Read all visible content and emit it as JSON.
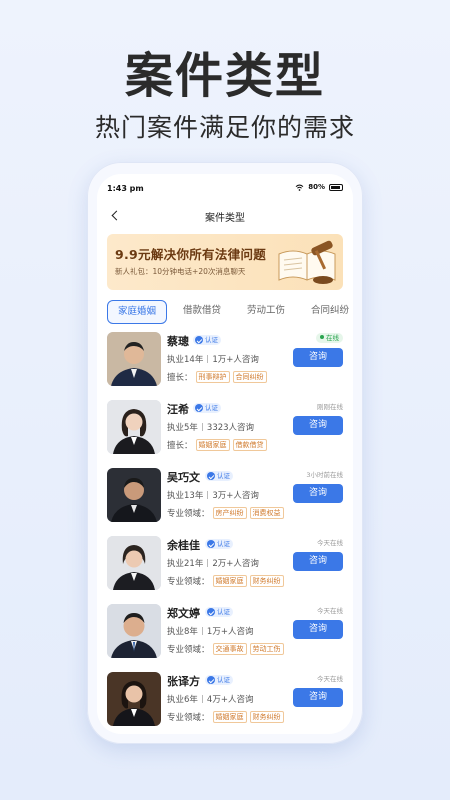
{
  "promo": {
    "title": "案件类型",
    "subtitle": "热门案件满足你的需求"
  },
  "status_bar": {
    "time": "1:43 pm",
    "battery": "80%"
  },
  "nav": {
    "title": "案件类型"
  },
  "banner": {
    "title": "9.9元解决你所有法律问题",
    "subtitle": "新人礼包：10分钟电话+20次消息聊天"
  },
  "tabs": [
    "家庭婚姻",
    "借款借贷",
    "劳动工伤",
    "合同纠纷"
  ],
  "lawyers": [
    {
      "name": "蔡璁",
      "verified": "认证",
      "years": "执业14年",
      "consults": "1万+人咨询",
      "field_label": "擅长：",
      "tags": [
        "刑事辩护",
        "合同纠纷"
      ],
      "status": "在线",
      "button": "咨询"
    },
    {
      "name": "汪希",
      "verified": "认证",
      "years": "执业5年",
      "consults": "3323人咨询",
      "field_label": "擅长：",
      "tags": [
        "婚姻家庭",
        "借款借贷"
      ],
      "status": "刚刚在线",
      "button": "咨询"
    },
    {
      "name": "吴巧文",
      "verified": "认证",
      "years": "执业13年",
      "consults": "3万+人咨询",
      "field_label": "专业领域：",
      "tags": [
        "房产纠纷",
        "消费权益"
      ],
      "status": "3小时前在线",
      "button": "咨询"
    },
    {
      "name": "余桂佳",
      "verified": "认证",
      "years": "执业21年",
      "consults": "2万+人咨询",
      "field_label": "专业领域：",
      "tags": [
        "婚姻家庭",
        "财务纠纷"
      ],
      "status": "今天在线",
      "button": "咨询"
    },
    {
      "name": "郑文婷",
      "verified": "认证",
      "years": "执业8年",
      "consults": "1万+人咨询",
      "field_label": "专业领域：",
      "tags": [
        "交通事故",
        "劳动工伤"
      ],
      "status": "今天在线",
      "button": "咨询"
    },
    {
      "name": "张译方",
      "verified": "认证",
      "years": "执业6年",
      "consults": "4万+人咨询",
      "field_label": "专业领域：",
      "tags": [
        "婚姻家庭",
        "财务纠纷"
      ],
      "status": "今天在线",
      "button": "咨询"
    }
  ],
  "colors": {
    "accent": "#3b78e7",
    "tag_text": "#d07a2c",
    "online": "#2aa44f"
  }
}
